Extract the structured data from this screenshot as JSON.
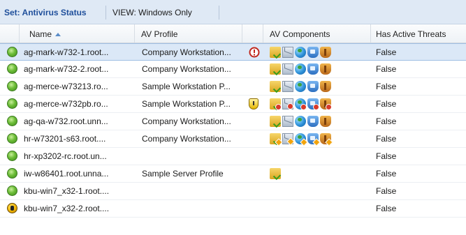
{
  "topbar": {
    "set_label": "Set: Antivirus Status",
    "view_label": "VIEW: Windows Only"
  },
  "columns": {
    "name": "Name",
    "profile": "AV Profile",
    "components": "AV Components",
    "threats": "Has Active Threats"
  },
  "rows": [
    {
      "name": "ag-mark-w732-1.root...",
      "profile": "Company Workstation...",
      "threats": "False",
      "status": "ok",
      "alert": "error",
      "components": "ok"
    },
    {
      "name": "ag-mark-w732-2.root...",
      "profile": "Company Workstation...",
      "threats": "False",
      "status": "ok",
      "alert": "",
      "components": "ok"
    },
    {
      "name": "ag-merce-w73213.ro...",
      "profile": "Sample Workstation P...",
      "threats": "False",
      "status": "ok",
      "alert": "",
      "components": "ok"
    },
    {
      "name": "ag-merce-w732pb.ro...",
      "profile": "Sample Workstation P...",
      "threats": "False",
      "status": "ok",
      "alert": "warning",
      "components": "error"
    },
    {
      "name": "ag-qa-w732.root.unn...",
      "profile": "Company Workstation...",
      "threats": "False",
      "status": "ok",
      "alert": "",
      "components": "ok"
    },
    {
      "name": "hr-w73201-s63.root....",
      "profile": "Company Workstation...",
      "threats": "False",
      "status": "ok",
      "alert": "",
      "components": "warning"
    },
    {
      "name": "hr-xp3202-rc.root.un...",
      "profile": "",
      "threats": "False",
      "status": "ok",
      "alert": "",
      "components": "none"
    },
    {
      "name": "iw-w86401.root.unna...",
      "profile": "Sample Server Profile",
      "threats": "False",
      "status": "ok",
      "alert": "",
      "components": "folder-only"
    },
    {
      "name": "kbu-win7_x32-1.root....",
      "profile": "",
      "threats": "False",
      "status": "ok",
      "alert": "",
      "components": "none"
    },
    {
      "name": "kbu-win7_x32-2.root....",
      "profile": "",
      "threats": "False",
      "status": "agent-alert",
      "alert": "",
      "components": "none"
    }
  ],
  "icons": {
    "status_ok": "green-status-icon",
    "status_agent": "agent-warning-icon",
    "row_alert_error": "red-alert-icon",
    "row_alert_warning": "yellow-shield-warning-icon",
    "components": [
      "folder-check-icon",
      "mail-icon",
      "globe-icon",
      "blue-shield-icon",
      "orange-shield-icon"
    ]
  },
  "colors": {
    "topbar_bg": "#dfe9f5",
    "set_label": "#1f4f9b",
    "selected_row": "#dbe8f7",
    "status_green": "#6dbd38",
    "alert_red": "#c0281d"
  }
}
